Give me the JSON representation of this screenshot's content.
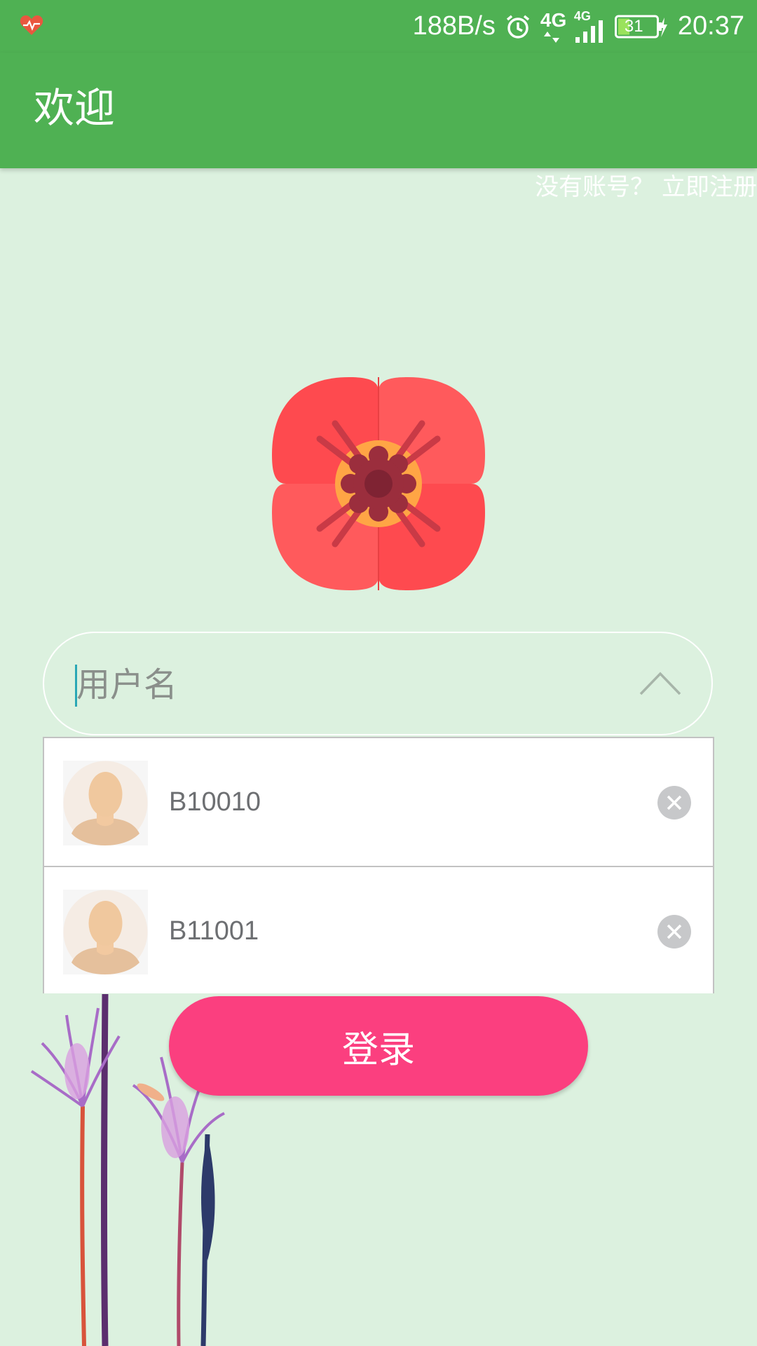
{
  "status_bar": {
    "speed": "188B/s",
    "network_1": "4G",
    "network_2": "4G",
    "battery": "31",
    "time": "20:37"
  },
  "app_bar": {
    "title": "欢迎"
  },
  "register_link": "没有账号？ 立即注册",
  "username": {
    "placeholder": "用户名",
    "value": ""
  },
  "accounts": [
    {
      "name": "B10010"
    },
    {
      "name": "B11001"
    }
  ],
  "login_label": "登录",
  "colors": {
    "app_bar": "#4fb153",
    "background": "#dcf1df",
    "login_button": "#fb3f7f"
  }
}
